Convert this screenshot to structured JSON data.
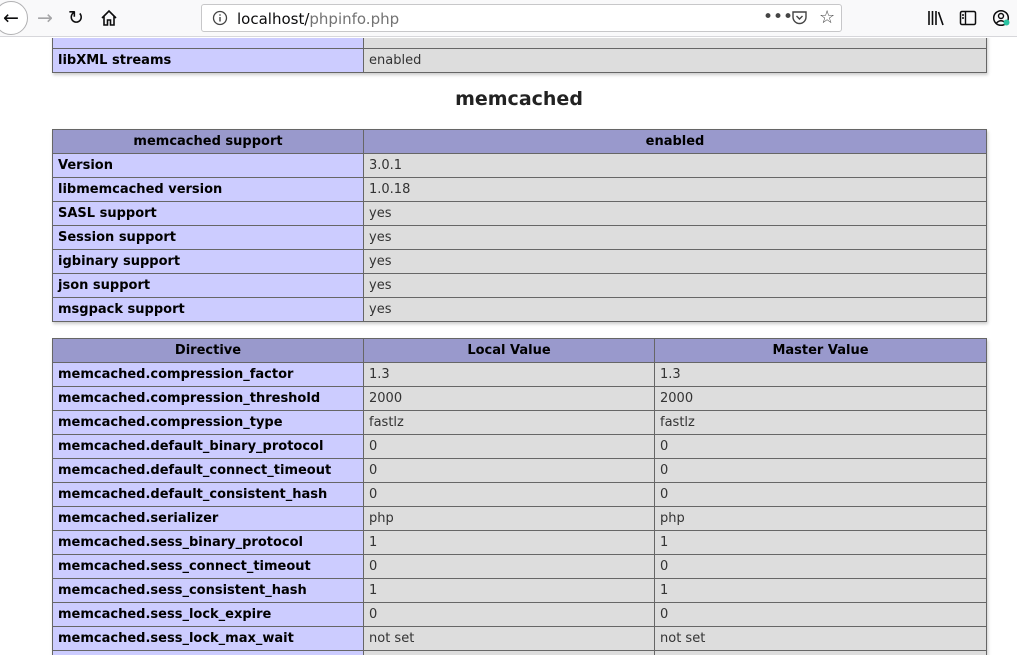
{
  "browser": {
    "url_host": "localhost/",
    "url_path": "phpinfo.php"
  },
  "top_table": {
    "rows": [
      {
        "key": "libXML streams",
        "value": "enabled"
      }
    ]
  },
  "section": {
    "title": "memcached"
  },
  "support_table": {
    "header": [
      "memcached support",
      "enabled"
    ],
    "rows": [
      {
        "key": "Version",
        "value": "3.0.1"
      },
      {
        "key": "libmemcached version",
        "value": "1.0.18"
      },
      {
        "key": "SASL support",
        "value": "yes"
      },
      {
        "key": "Session support",
        "value": "yes"
      },
      {
        "key": "igbinary support",
        "value": "yes"
      },
      {
        "key": "json support",
        "value": "yes"
      },
      {
        "key": "msgpack support",
        "value": "yes"
      }
    ]
  },
  "directive_table": {
    "header": [
      "Directive",
      "Local Value",
      "Master Value"
    ],
    "rows": [
      {
        "directive": "memcached.compression_factor",
        "local": "1.3",
        "master": "1.3"
      },
      {
        "directive": "memcached.compression_threshold",
        "local": "2000",
        "master": "2000"
      },
      {
        "directive": "memcached.compression_type",
        "local": "fastlz",
        "master": "fastlz"
      },
      {
        "directive": "memcached.default_binary_protocol",
        "local": "0",
        "master": "0"
      },
      {
        "directive": "memcached.default_connect_timeout",
        "local": "0",
        "master": "0"
      },
      {
        "directive": "memcached.default_consistent_hash",
        "local": "0",
        "master": "0"
      },
      {
        "directive": "memcached.serializer",
        "local": "php",
        "master": "php"
      },
      {
        "directive": "memcached.sess_binary_protocol",
        "local": "1",
        "master": "1"
      },
      {
        "directive": "memcached.sess_connect_timeout",
        "local": "0",
        "master": "0"
      },
      {
        "directive": "memcached.sess_consistent_hash",
        "local": "1",
        "master": "1"
      },
      {
        "directive": "memcached.sess_lock_expire",
        "local": "0",
        "master": "0"
      },
      {
        "directive": "memcached.sess_lock_max_wait",
        "local": "not set",
        "master": "not set"
      }
    ]
  }
}
